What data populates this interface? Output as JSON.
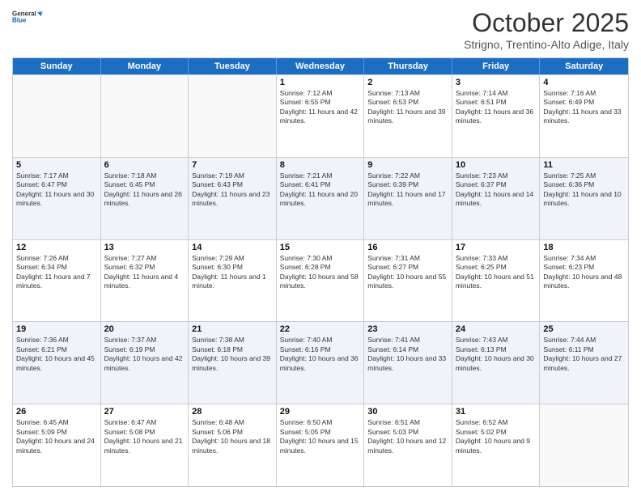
{
  "header": {
    "logo_general": "General",
    "logo_blue": "Blue",
    "month_title": "October 2025",
    "subtitle": "Strigno, Trentino-Alto Adige, Italy"
  },
  "days_of_week": [
    "Sunday",
    "Monday",
    "Tuesday",
    "Wednesday",
    "Thursday",
    "Friday",
    "Saturday"
  ],
  "weeks": [
    [
      {
        "day": "",
        "info": ""
      },
      {
        "day": "",
        "info": ""
      },
      {
        "day": "",
        "info": ""
      },
      {
        "day": "1",
        "info": "Sunrise: 7:12 AM\nSunset: 6:55 PM\nDaylight: 11 hours and 42 minutes."
      },
      {
        "day": "2",
        "info": "Sunrise: 7:13 AM\nSunset: 6:53 PM\nDaylight: 11 hours and 39 minutes."
      },
      {
        "day": "3",
        "info": "Sunrise: 7:14 AM\nSunset: 6:51 PM\nDaylight: 11 hours and 36 minutes."
      },
      {
        "day": "4",
        "info": "Sunrise: 7:16 AM\nSunset: 6:49 PM\nDaylight: 11 hours and 33 minutes."
      }
    ],
    [
      {
        "day": "5",
        "info": "Sunrise: 7:17 AM\nSunset: 6:47 PM\nDaylight: 11 hours and 30 minutes."
      },
      {
        "day": "6",
        "info": "Sunrise: 7:18 AM\nSunset: 6:45 PM\nDaylight: 11 hours and 26 minutes."
      },
      {
        "day": "7",
        "info": "Sunrise: 7:19 AM\nSunset: 6:43 PM\nDaylight: 11 hours and 23 minutes."
      },
      {
        "day": "8",
        "info": "Sunrise: 7:21 AM\nSunset: 6:41 PM\nDaylight: 11 hours and 20 minutes."
      },
      {
        "day": "9",
        "info": "Sunrise: 7:22 AM\nSunset: 6:39 PM\nDaylight: 11 hours and 17 minutes."
      },
      {
        "day": "10",
        "info": "Sunrise: 7:23 AM\nSunset: 6:37 PM\nDaylight: 11 hours and 14 minutes."
      },
      {
        "day": "11",
        "info": "Sunrise: 7:25 AM\nSunset: 6:36 PM\nDaylight: 11 hours and 10 minutes."
      }
    ],
    [
      {
        "day": "12",
        "info": "Sunrise: 7:26 AM\nSunset: 6:34 PM\nDaylight: 11 hours and 7 minutes."
      },
      {
        "day": "13",
        "info": "Sunrise: 7:27 AM\nSunset: 6:32 PM\nDaylight: 11 hours and 4 minutes."
      },
      {
        "day": "14",
        "info": "Sunrise: 7:29 AM\nSunset: 6:30 PM\nDaylight: 11 hours and 1 minute."
      },
      {
        "day": "15",
        "info": "Sunrise: 7:30 AM\nSunset: 6:28 PM\nDaylight: 10 hours and 58 minutes."
      },
      {
        "day": "16",
        "info": "Sunrise: 7:31 AM\nSunset: 6:27 PM\nDaylight: 10 hours and 55 minutes."
      },
      {
        "day": "17",
        "info": "Sunrise: 7:33 AM\nSunset: 6:25 PM\nDaylight: 10 hours and 51 minutes."
      },
      {
        "day": "18",
        "info": "Sunrise: 7:34 AM\nSunset: 6:23 PM\nDaylight: 10 hours and 48 minutes."
      }
    ],
    [
      {
        "day": "19",
        "info": "Sunrise: 7:36 AM\nSunset: 6:21 PM\nDaylight: 10 hours and 45 minutes."
      },
      {
        "day": "20",
        "info": "Sunrise: 7:37 AM\nSunset: 6:19 PM\nDaylight: 10 hours and 42 minutes."
      },
      {
        "day": "21",
        "info": "Sunrise: 7:38 AM\nSunset: 6:18 PM\nDaylight: 10 hours and 39 minutes."
      },
      {
        "day": "22",
        "info": "Sunrise: 7:40 AM\nSunset: 6:16 PM\nDaylight: 10 hours and 36 minutes."
      },
      {
        "day": "23",
        "info": "Sunrise: 7:41 AM\nSunset: 6:14 PM\nDaylight: 10 hours and 33 minutes."
      },
      {
        "day": "24",
        "info": "Sunrise: 7:43 AM\nSunset: 6:13 PM\nDaylight: 10 hours and 30 minutes."
      },
      {
        "day": "25",
        "info": "Sunrise: 7:44 AM\nSunset: 6:11 PM\nDaylight: 10 hours and 27 minutes."
      }
    ],
    [
      {
        "day": "26",
        "info": "Sunrise: 6:45 AM\nSunset: 5:09 PM\nDaylight: 10 hours and 24 minutes."
      },
      {
        "day": "27",
        "info": "Sunrise: 6:47 AM\nSunset: 5:08 PM\nDaylight: 10 hours and 21 minutes."
      },
      {
        "day": "28",
        "info": "Sunrise: 6:48 AM\nSunset: 5:06 PM\nDaylight: 10 hours and 18 minutes."
      },
      {
        "day": "29",
        "info": "Sunrise: 6:50 AM\nSunset: 5:05 PM\nDaylight: 10 hours and 15 minutes."
      },
      {
        "day": "30",
        "info": "Sunrise: 6:51 AM\nSunset: 5:03 PM\nDaylight: 10 hours and 12 minutes."
      },
      {
        "day": "31",
        "info": "Sunrise: 6:52 AM\nSunset: 5:02 PM\nDaylight: 10 hours and 9 minutes."
      },
      {
        "day": "",
        "info": ""
      }
    ]
  ]
}
